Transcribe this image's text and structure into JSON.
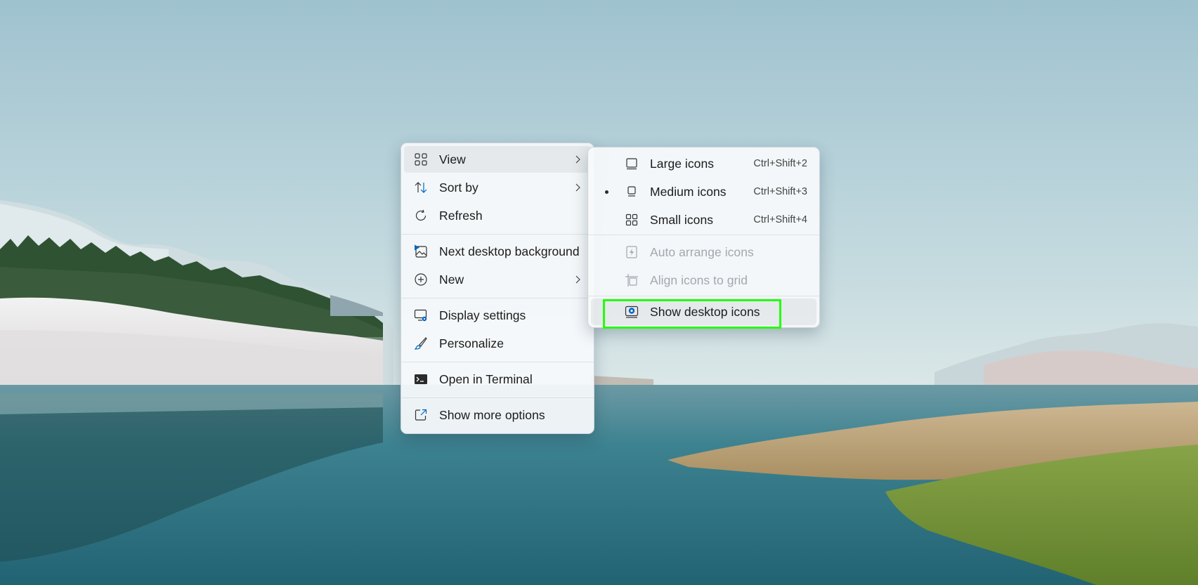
{
  "desktop": {
    "wallpaper_colors": {
      "sky_top": "#a8c9d4",
      "sky_bottom": "#d5e4e6",
      "water": "#2f7684",
      "grass": "#7d9a3c",
      "reeds": "#c9b189"
    }
  },
  "context_menu": {
    "items": [
      {
        "label": "View",
        "icon": "view-grid-icon",
        "has_submenu": true
      },
      {
        "label": "Sort by",
        "icon": "sort-icon",
        "has_submenu": true
      },
      {
        "label": "Refresh",
        "icon": "refresh-icon"
      },
      {
        "label": "Next desktop background",
        "icon": "next-background-icon"
      },
      {
        "label": "New",
        "icon": "new-plus-icon",
        "has_submenu": true
      },
      {
        "label": "Display settings",
        "icon": "display-settings-icon"
      },
      {
        "label": "Personalize",
        "icon": "personalize-brush-icon"
      },
      {
        "label": "Open in Terminal",
        "icon": "terminal-icon"
      },
      {
        "label": "Show more options",
        "icon": "show-more-options-icon"
      }
    ]
  },
  "view_submenu": {
    "items": [
      {
        "label": "Large icons",
        "shortcut": "Ctrl+Shift+2",
        "icon": "large-icons-icon"
      },
      {
        "label": "Medium icons",
        "shortcut": "Ctrl+Shift+3",
        "icon": "medium-icons-icon",
        "selected": true
      },
      {
        "label": "Small icons",
        "shortcut": "Ctrl+Shift+4",
        "icon": "small-icons-icon"
      },
      {
        "label": "Auto arrange icons",
        "icon": "auto-arrange-icon",
        "disabled": true
      },
      {
        "label": "Align icons to grid",
        "icon": "align-grid-icon",
        "disabled": true
      },
      {
        "label": "Show desktop icons",
        "icon": "show-desktop-icons-icon",
        "checked": true
      }
    ]
  },
  "highlight_color": "#22ff0b",
  "accent_color": "#0067c0"
}
